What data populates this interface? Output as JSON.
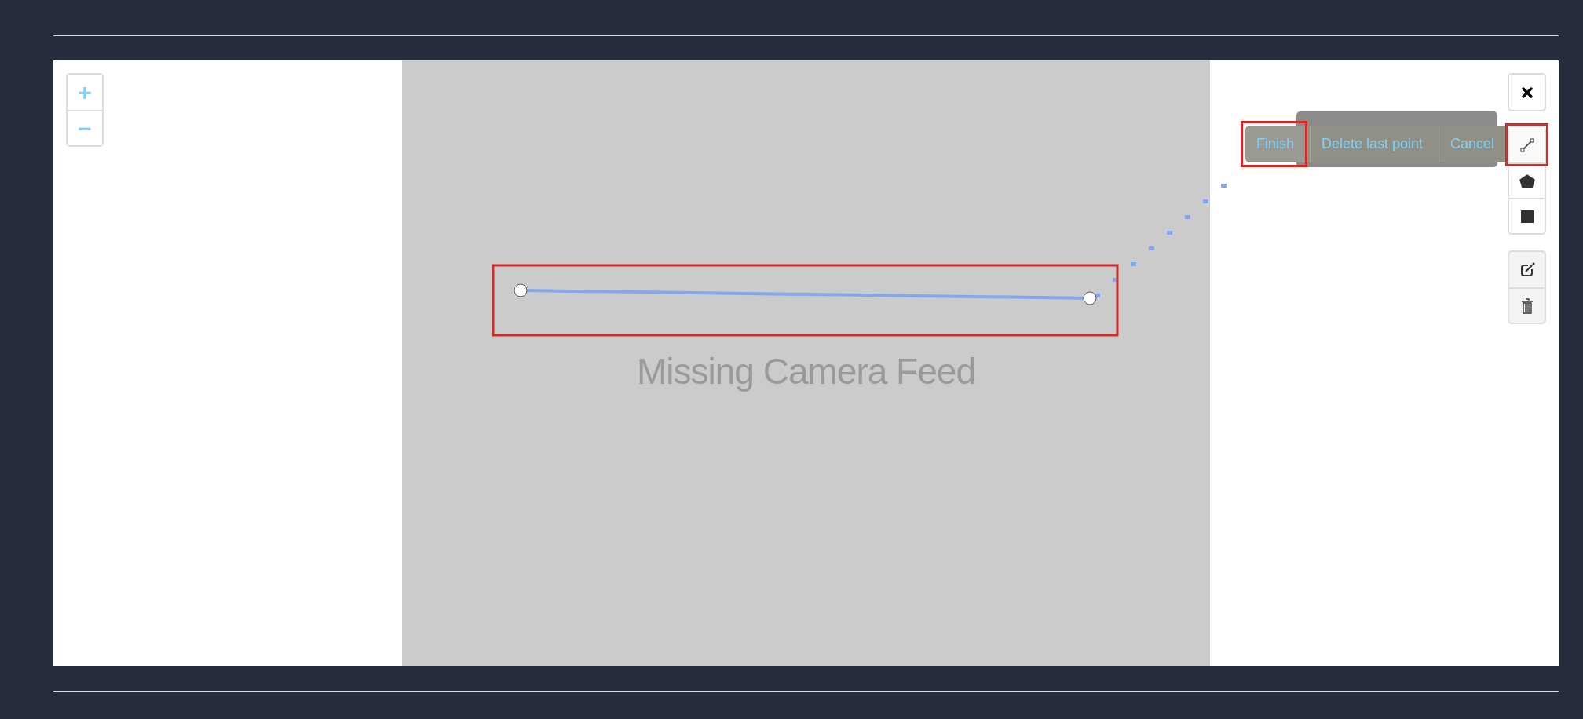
{
  "zoom_controls": [
    {
      "label": "+"
    },
    {
      "label": "−"
    }
  ],
  "camera": {
    "message": "Missing Camera Feed"
  },
  "drawing": {
    "kind": "polyline",
    "highlighted": true
  },
  "action_bar": [
    {
      "label": "Finish",
      "highlighted": true
    },
    {
      "label": "Delete last point",
      "highlighted": false
    },
    {
      "label": "Cancel",
      "highlighted": false
    }
  ],
  "toolbar": [
    [
      {
        "kind": "close",
        "highlighted": false
      }
    ],
    [
      {
        "kind": "polyline",
        "highlighted": true
      },
      {
        "kind": "polygon",
        "highlighted": false
      },
      {
        "kind": "rectangle",
        "highlighted": false
      }
    ],
    [
      {
        "kind": "edit",
        "highlighted": false
      },
      {
        "kind": "delete",
        "highlighted": false
      }
    ]
  ]
}
